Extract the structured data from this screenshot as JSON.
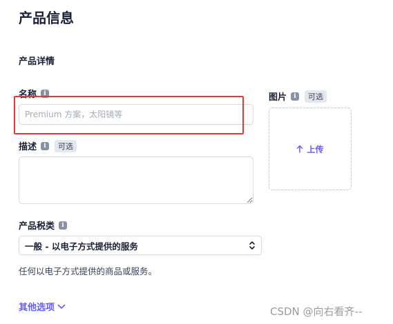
{
  "page": {
    "title": "产品信息",
    "section_title": "产品详情"
  },
  "name_field": {
    "label": "名称",
    "info_icon": "info-icon",
    "placeholder": "Premium 方案，太阳镜等",
    "value": ""
  },
  "description_field": {
    "label": "描述",
    "info_icon": "info-icon",
    "optional": "可选",
    "value": ""
  },
  "tax_category": {
    "label": "产品税类",
    "info_icon": "info-icon",
    "selected": "一般 - 以电子方式提供的服务",
    "help": "任何以电子方式提供的商品或服务。"
  },
  "image_field": {
    "label": "图片",
    "info_icon": "info-icon",
    "optional": "可选",
    "upload_label": "上传",
    "upload_icon": "arrow-up-icon"
  },
  "more_options": {
    "label": "其他选项",
    "icon": "chevron-down-icon"
  },
  "watermark": "CSDN @向右看齐--",
  "colors": {
    "accent": "#635bff",
    "highlight": "#e53935",
    "text": "#1a1f36",
    "muted": "#3c4257"
  }
}
